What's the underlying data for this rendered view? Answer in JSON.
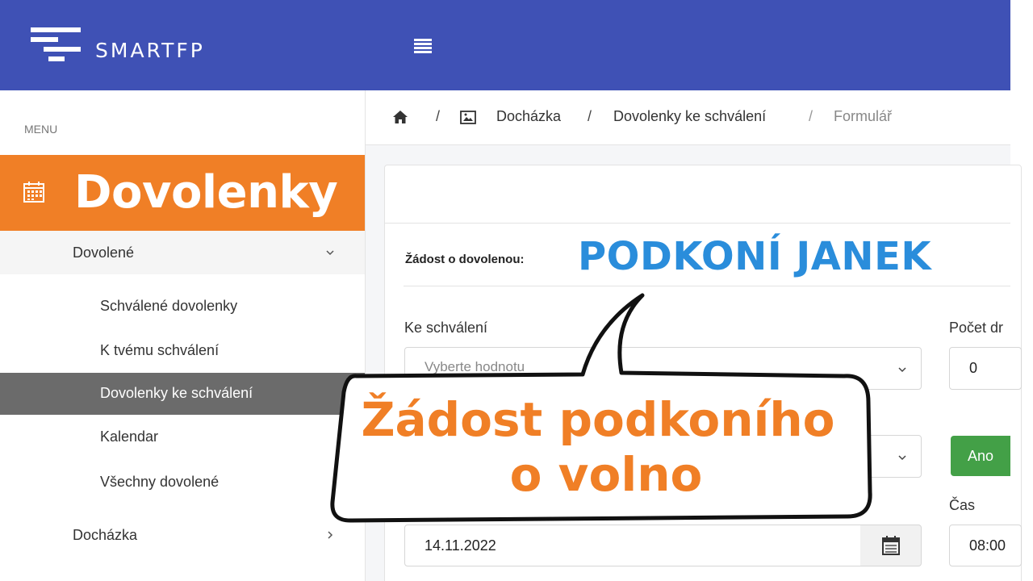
{
  "app": {
    "name": "SMARTFP"
  },
  "sidebar": {
    "menu_label": "MENU",
    "hero_title": "Dovolenky",
    "group": "Dovolené",
    "items": [
      {
        "label": "Schválené dovolenky",
        "active": false
      },
      {
        "label": "K tvému schválení",
        "active": false
      },
      {
        "label": "Dovolenky ke schválení",
        "active": true
      },
      {
        "label": "Kalendar",
        "active": false
      },
      {
        "label": "Všechny dovolené",
        "active": false
      }
    ],
    "section": "Docházka"
  },
  "breadcrumb": {
    "sep": "/",
    "items": [
      "Docházka",
      "Dovolenky ke schválení",
      "Formulář"
    ]
  },
  "form": {
    "request_label": "Žádost o dovolenou:",
    "request_name": "PODKONÍ JANEK",
    "approver_label": "Ke schválení",
    "approver_placeholder": "Vyberte hodnotu",
    "days_label": "Počet dr",
    "days_value": "0",
    "yes_button": "Ano",
    "time_label": "Čas",
    "date_value": "14.11.2022",
    "time_value": "08:00"
  },
  "callout": {
    "line1": "Žádost podkoního",
    "line2": "o volno"
  },
  "colors": {
    "topbar": "#3f51b5",
    "accent_orange": "#f07f26",
    "name_blue": "#2a8ddb",
    "active_item": "#6b6b6b",
    "yes_green": "#43a047"
  },
  "icons": [
    "hamburger-icon",
    "calendar-icon",
    "home-icon",
    "image-icon",
    "chevron-down-icon",
    "chevron-right-icon"
  ]
}
